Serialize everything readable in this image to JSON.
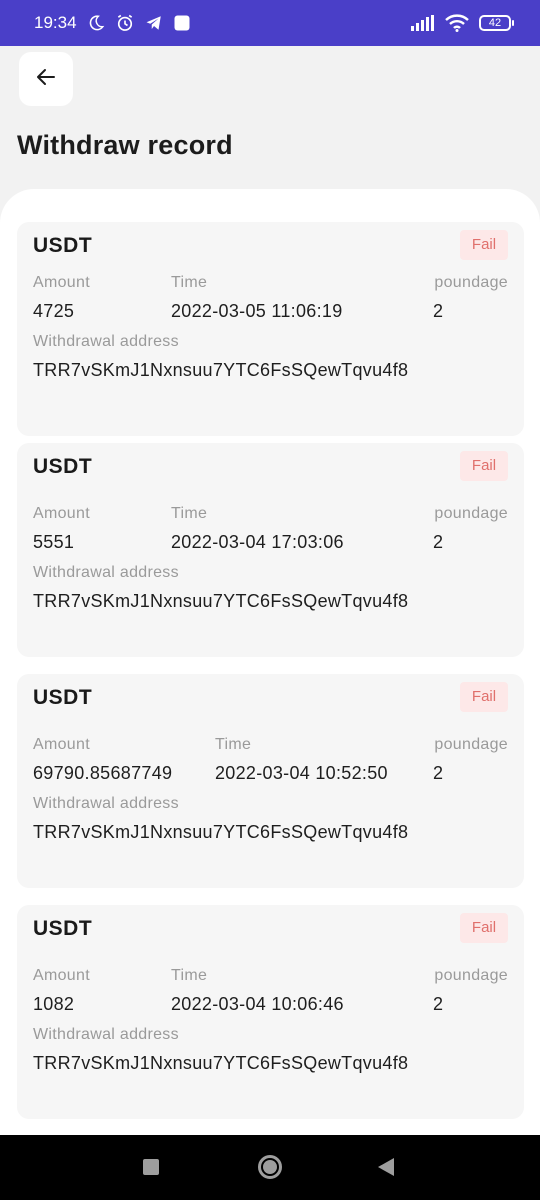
{
  "status_bar": {
    "time": "19:34",
    "battery": "42",
    "icons": [
      "moon-icon",
      "alarm-icon",
      "telegram-icon",
      "app-square-icon",
      "signal-icon",
      "wifi-icon",
      "battery-icon"
    ]
  },
  "header": {
    "title": "Withdraw record"
  },
  "labels": {
    "amount": "Amount",
    "time": "Time",
    "poundage": "poundage",
    "address": "Withdrawal address"
  },
  "records": [
    {
      "currency": "USDT",
      "status": "Fail",
      "amount": "4725",
      "time": "2022-03-05 11:06:19",
      "poundage": "2",
      "address": "TRR7vSKmJ1Nxnsuu7YTC6FsSQewTqvu4f8"
    },
    {
      "currency": "USDT",
      "status": "Fail",
      "amount": "5551",
      "time": "2022-03-04 17:03:06",
      "poundage": "2",
      "address": "TRR7vSKmJ1Nxnsuu7YTC6FsSQewTqvu4f8"
    },
    {
      "currency": "USDT",
      "status": "Fail",
      "amount": "69790.85687749",
      "time": "2022-03-04 10:52:50",
      "poundage": "2",
      "address": "TRR7vSKmJ1Nxnsuu7YTC6FsSQewTqvu4f8"
    },
    {
      "currency": "USDT",
      "status": "Fail",
      "amount": "1082",
      "time": "2022-03-04 10:06:46",
      "poundage": "2",
      "address": "TRR7vSKmJ1Nxnsuu7YTC6FsSQewTqvu4f8"
    }
  ],
  "colors": {
    "status_bar": "#4a3fc8",
    "fail_text": "#e0706c",
    "fail_bg": "#fde8e8"
  }
}
